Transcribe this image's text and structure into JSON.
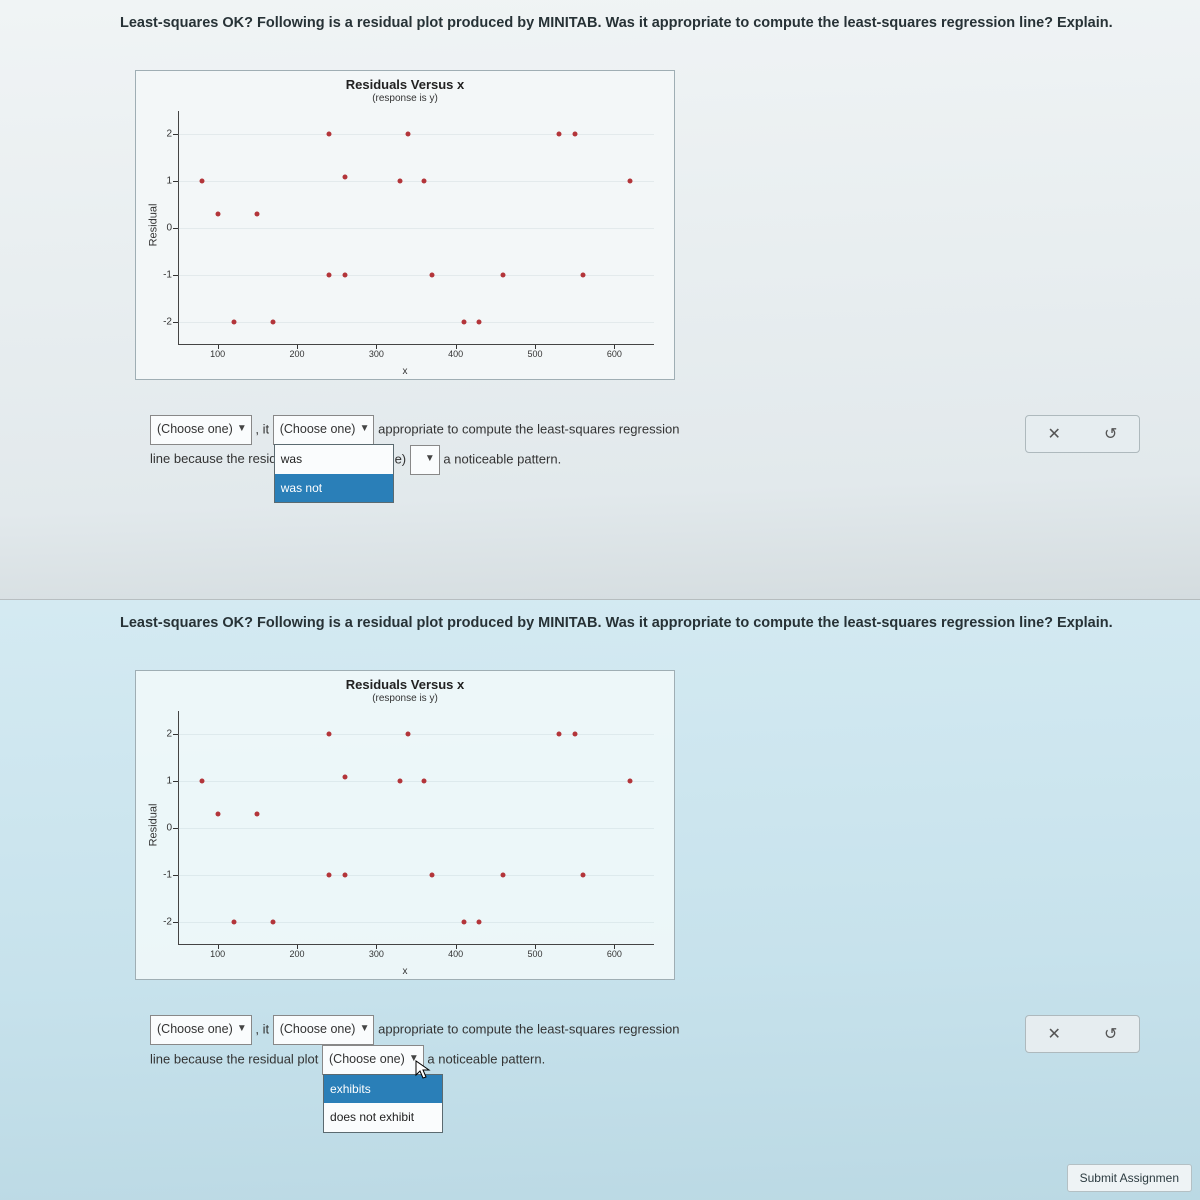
{
  "question": {
    "bold": "Least-squares OK?",
    "rest": " Following is a residual plot produced by MINITAB. Was it appropriate to compute the least-squares regression line? Explain."
  },
  "chart_data": {
    "type": "scatter",
    "title": "Residuals Versus x",
    "subtitle": "(response is y)",
    "ylabel": "Residual",
    "xlabel": "x",
    "xlim": [
      50,
      650
    ],
    "ylim": [
      -2.5,
      2.5
    ],
    "xticks": [
      100,
      200,
      300,
      400,
      500,
      600
    ],
    "yticks": [
      -2,
      -1,
      0,
      1,
      2
    ],
    "points": [
      {
        "x": 80,
        "y": 1.0
      },
      {
        "x": 100,
        "y": 0.3
      },
      {
        "x": 120,
        "y": -2.0
      },
      {
        "x": 150,
        "y": 0.3
      },
      {
        "x": 170,
        "y": -2.0
      },
      {
        "x": 240,
        "y": 2.0
      },
      {
        "x": 240,
        "y": -1.0
      },
      {
        "x": 260,
        "y": 1.1
      },
      {
        "x": 260,
        "y": -1.0
      },
      {
        "x": 330,
        "y": 1.0
      },
      {
        "x": 340,
        "y": 2.0
      },
      {
        "x": 360,
        "y": 1.0
      },
      {
        "x": 370,
        "y": -1.0
      },
      {
        "x": 410,
        "y": -2.0
      },
      {
        "x": 430,
        "y": -2.0
      },
      {
        "x": 460,
        "y": -1.0
      },
      {
        "x": 530,
        "y": 2.0
      },
      {
        "x": 550,
        "y": 2.0
      },
      {
        "x": 560,
        "y": -1.0
      },
      {
        "x": 620,
        "y": 1.0
      }
    ]
  },
  "answer_top": {
    "dd1_label": "(Choose one)",
    "sep1": ", it",
    "dd2_label": "(Choose one)",
    "tail1_a": "appropriate to compute the least-squares regression",
    "tail1_b": "line because the resid",
    "dd2_opts": [
      "was",
      "was not"
    ],
    "dd2_sel": "was not",
    "partial": "one)",
    "tail2": " a noticeable pattern."
  },
  "answer_bot": {
    "dd1_label": "(Choose one)",
    "sep1": ", it",
    "dd2_label": "(Choose one)",
    "tail1_a": "appropriate to compute the least-squares regression",
    "tail1_b": "line because the residual plot",
    "dd3_label": "(Choose one)",
    "dd3_opts": [
      "exhibits",
      "does not exhibit"
    ],
    "dd3_sel": "exhibits",
    "tail2": " a noticeable pattern."
  },
  "tools": {
    "close": "✕",
    "reset": "↺"
  },
  "submit": "Submit Assignmen"
}
